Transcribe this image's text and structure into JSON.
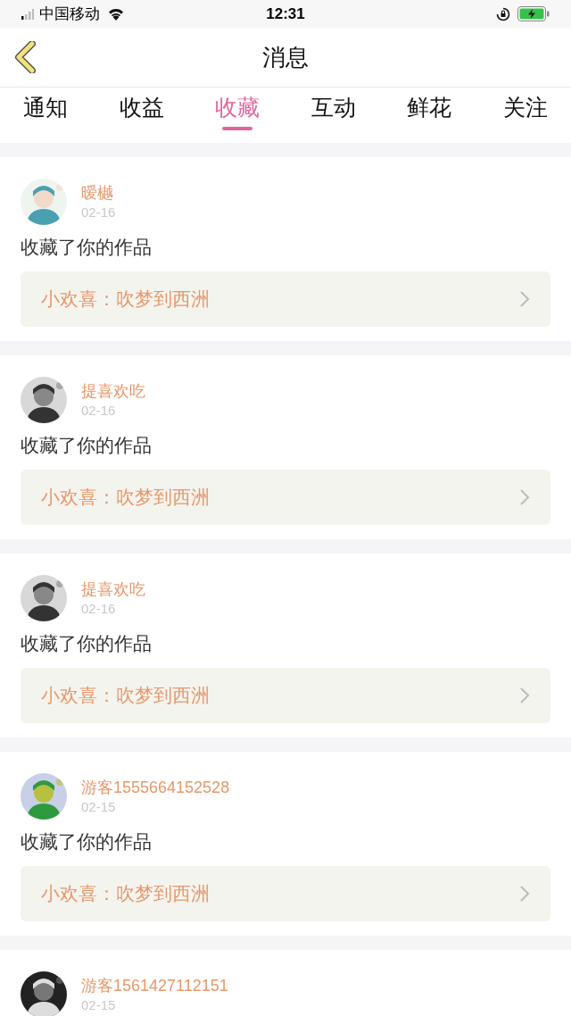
{
  "status_bar": {
    "carrier": "中国移动",
    "time": "12:31"
  },
  "header": {
    "title": "消息"
  },
  "tabs": [
    {
      "label": "通知",
      "selected": false
    },
    {
      "label": "收益",
      "selected": false
    },
    {
      "label": "收藏",
      "selected": true
    },
    {
      "label": "互动",
      "selected": false
    },
    {
      "label": "鲜花",
      "selected": false
    },
    {
      "label": "关注",
      "selected": false
    }
  ],
  "messages": [
    {
      "user": "暧樾",
      "date": "02-16",
      "action": "收藏了你的作品",
      "work": "小欢喜：吹梦到西洲"
    },
    {
      "user": "提喜欢吃",
      "date": "02-16",
      "action": "收藏了你的作品",
      "work": "小欢喜：吹梦到西洲"
    },
    {
      "user": "提喜欢吃",
      "date": "02-16",
      "action": "收藏了你的作品",
      "work": "小欢喜：吹梦到西洲"
    },
    {
      "user": "游客1555664152528",
      "date": "02-15",
      "action": "收藏了你的作品",
      "work": "小欢喜：吹梦到西洲"
    },
    {
      "user": "游客1561427112151",
      "date": "02-15"
    }
  ]
}
